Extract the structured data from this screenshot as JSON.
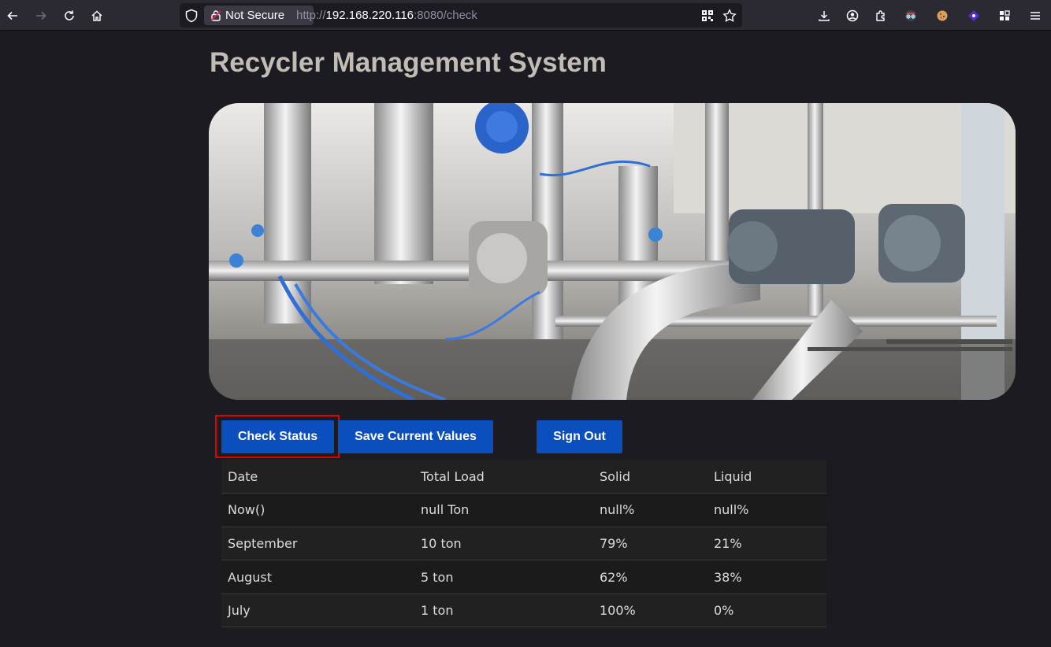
{
  "browser": {
    "security_label": "Not Secure",
    "url_scheme": "http://",
    "url_host": "192.168.220.116",
    "url_rest": ":8080/check",
    "icons": [
      "back-icon",
      "forward-icon",
      "reload-icon",
      "home-icon",
      "shield-icon",
      "lock-icon",
      "qr-icon",
      "star-icon",
      "download-icon",
      "account-icon",
      "extensions-icon",
      "extension-glasses-icon",
      "extension-cookie-icon",
      "extension-diamond-icon",
      "apps-icon",
      "menu-icon"
    ]
  },
  "page": {
    "title": "Recycler Management System",
    "hero_image": "industrial-machinery-photo"
  },
  "buttons": {
    "check_status": "Check Status",
    "save_values": "Save Current Values",
    "sign_out": "Sign Out"
  },
  "table": {
    "headers": [
      "Date",
      "Total Load",
      "Solid",
      "Liquid"
    ],
    "rows": [
      [
        "Now()",
        "null Ton",
        "null%",
        "null%"
      ],
      [
        "September",
        "10 ton",
        "79%",
        "21%"
      ],
      [
        "August",
        "5 ton",
        "62%",
        "38%"
      ],
      [
        "July",
        "1 ton",
        "100%",
        "0%"
      ]
    ]
  },
  "colors": {
    "background": "#1c1b22",
    "button": "#0b4fbf",
    "highlight": "#e00000",
    "title": "#c2bdb4"
  }
}
